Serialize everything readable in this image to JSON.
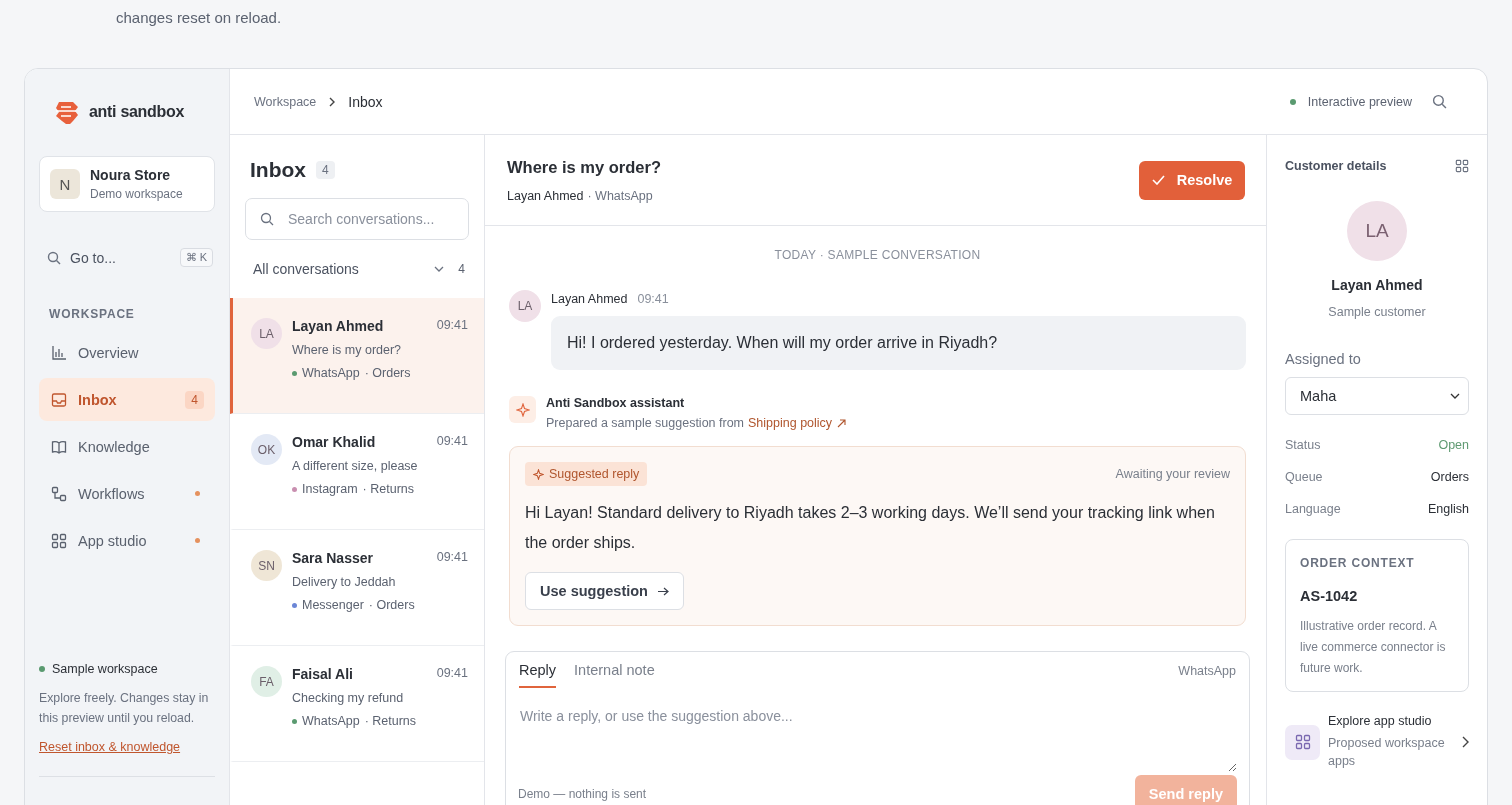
{
  "intro_text": "changes reset on reload.",
  "sidebar": {
    "brand": "anti sandbox",
    "workspace": {
      "initial": "N",
      "name": "Noura Store",
      "subtitle": "Demo workspace"
    },
    "goto": {
      "label": "Go to...",
      "keys": [
        "⌘",
        "K"
      ]
    },
    "section_label": "WORKSPACE",
    "items": [
      {
        "label": "Overview",
        "selected": false,
        "dot": false
      },
      {
        "label": "Inbox",
        "selected": true,
        "badge": "4",
        "dot": false
      },
      {
        "label": "Knowledge",
        "selected": false,
        "dot": false
      },
      {
        "label": "Workflows",
        "selected": false,
        "dot": true
      },
      {
        "label": "App studio",
        "selected": false,
        "dot": true
      }
    ],
    "notice": {
      "title": "Sample workspace",
      "text": "Explore freely. Changes stay in this preview until you reload.",
      "link": "Reset inbox & knowledge"
    }
  },
  "header": {
    "breadcrumb": [
      "Workspace",
      "Inbox"
    ],
    "status": "Interactive preview"
  },
  "inbox": {
    "title": "Inbox",
    "count": "4",
    "search_placeholder": "Search conversations...",
    "filter": "All conversations",
    "filter_count": "4",
    "conversations": [
      {
        "avatar": {
          "initials": "LA",
          "color": "#f0e0e8"
        },
        "name": "Layan Ahmed",
        "time": "09:41",
        "preview": "Where is my order?",
        "channel": "WhatsApp",
        "queue": "· Orders",
        "color": "#5a9a70",
        "selected": true
      },
      {
        "avatar": {
          "initials": "OK",
          "color": "#e3e9f5"
        },
        "name": "Omar Khalid",
        "time": "09:41",
        "preview": "A different size, please",
        "channel": "Instagram",
        "queue": "· Returns",
        "color": "#c98fb0",
        "selected": false
      },
      {
        "avatar": {
          "initials": "SN",
          "color": "#efe6d6"
        },
        "name": "Sara Nasser",
        "time": "09:41",
        "preview": "Delivery to Jeddah",
        "channel": "Messenger",
        "queue": "· Orders",
        "color": "#6b86d6",
        "selected": false
      },
      {
        "avatar": {
          "initials": "FA",
          "color": "#e0efe6"
        },
        "name": "Faisal Ali",
        "time": "09:41",
        "preview": "Checking my refund",
        "channel": "WhatsApp",
        "queue": "· Returns",
        "color": "#5a9a70",
        "selected": false
      }
    ]
  },
  "conversation": {
    "title": "Where is my order?",
    "customer": "Layan Ahmed",
    "channel": "· WhatsApp",
    "resolve": "Resolve",
    "day_label": "TODAY · SAMPLE CONVERSATION",
    "message": {
      "initials": "LA",
      "author": "Layan Ahmed",
      "time": "09:41",
      "text": "Hi! I ordered yesterday. When will my order arrive in Riyadh?"
    },
    "assistant": {
      "name": "Anti Sandbox assistant",
      "text": "Prepared a sample suggestion from",
      "link": "Shipping policy"
    },
    "suggestion": {
      "tag": "Suggested reply",
      "status": "Awaiting your review",
      "text": "Hi Layan! Standard delivery to Riyadh takes 2–3 working days. We’ll send your tracking link when the order ships.",
      "action": "Use suggestion"
    },
    "composer": {
      "tabs": [
        {
          "label": "Reply",
          "selected": true
        },
        {
          "label": "Internal note",
          "selected": false
        }
      ],
      "channel": "WhatsApp",
      "placeholder": "Write a reply, or use the suggestion above...",
      "note": "Demo — nothing is sent",
      "send": "Send reply",
      "send_disabled": true
    }
  },
  "details": {
    "title": "Customer details",
    "initials": "LA",
    "name": "Layan Ahmed",
    "subtitle": "Sample customer",
    "assigned_label": "Assigned to",
    "assignee": "Maha",
    "fields": [
      {
        "label": "Status",
        "value": "Open",
        "color": "#5f9a72"
      },
      {
        "label": "Queue",
        "value": "Orders",
        "color": "#2b2f36"
      },
      {
        "label": "Language",
        "value": "English",
        "color": "#2b2f36"
      }
    ],
    "order": {
      "heading": "ORDER CONTEXT",
      "id": "AS-1042",
      "text": "Illustrative order record. A live commerce connector is future work."
    },
    "app_link": {
      "title": "Explore app studio",
      "subtitle": "Proposed workspace apps"
    }
  }
}
